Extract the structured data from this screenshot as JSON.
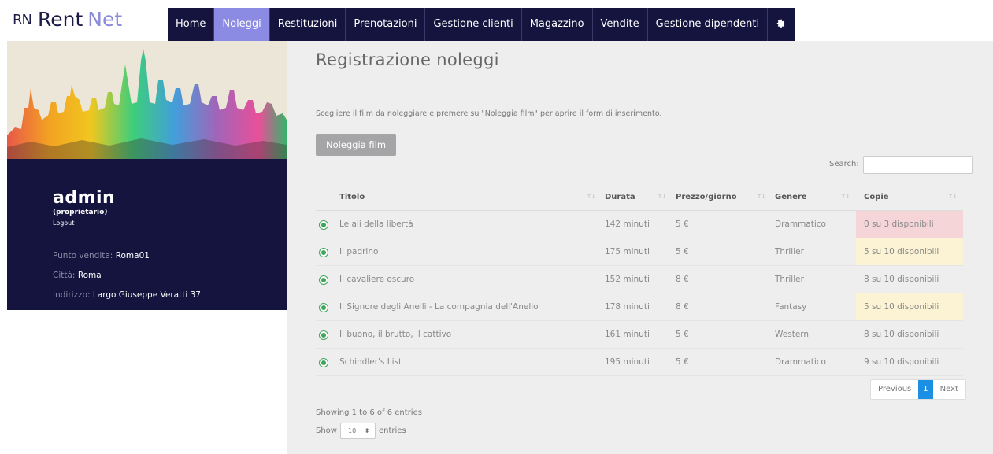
{
  "brand": {
    "mark": "RN",
    "name_a": "Rent",
    "name_b": "Net"
  },
  "nav": {
    "items": [
      {
        "label": "Home"
      },
      {
        "label": "Noleggi"
      },
      {
        "label": "Restituzioni"
      },
      {
        "label": "Prenotazioni"
      },
      {
        "label": "Gestione clienti"
      },
      {
        "label": "Magazzino"
      },
      {
        "label": "Vendite"
      },
      {
        "label": "Gestione dipendenti"
      }
    ],
    "active": "Noleggi",
    "settings_icon": "gear-icon"
  },
  "sidebar": {
    "user": "admin",
    "role": "(proprietario)",
    "logout": "Logout",
    "store_label": "Punto vendita:",
    "store": "Roma01",
    "city_label": "Città:",
    "city": "Roma",
    "address_label": "Indirizzo:",
    "address": "Largo Giuseppe Veratti 37"
  },
  "main": {
    "title": "Registrazione noleggi",
    "intro": "Scegliere il film da noleggiare e premere su \"Noleggia film\" per aprire il form di inserimento.",
    "rent_button": "Noleggia film",
    "search_label": "Search:",
    "search_value": ""
  },
  "table": {
    "columns": [
      "Titolo",
      "Durata",
      "Prezzo/giorno",
      "Genere",
      "Copie"
    ],
    "rows": [
      {
        "title": "Le ali della libertà",
        "duration": "142 minuti",
        "price": "5 €",
        "genre": "Drammatico",
        "copies": "0 su 3 disponibili",
        "status": "red"
      },
      {
        "title": "Il padrino",
        "duration": "175 minuti",
        "price": "5 €",
        "genre": "Thriller",
        "copies": "5 su 10 disponibili",
        "status": "yellow"
      },
      {
        "title": "Il cavaliere oscuro",
        "duration": "152 minuti",
        "price": "8 €",
        "genre": "Thriller",
        "copies": "8 su 10 disponibili",
        "status": "none"
      },
      {
        "title": "Il Signore degli Anelli - La compagnia dell'Anello",
        "duration": "178 minuti",
        "price": "8 €",
        "genre": "Fantasy",
        "copies": "5 su 10 disponibili",
        "status": "yellow"
      },
      {
        "title": "Il buono, il brutto, il cattivo",
        "duration": "161 minuti",
        "price": "5 €",
        "genre": "Western",
        "copies": "8 su 10 disponibili",
        "status": "none"
      },
      {
        "title": "Schindler's List",
        "duration": "195 minuti",
        "price": "5 €",
        "genre": "Drammatico",
        "copies": "9 su 10 disponibili",
        "status": "none"
      }
    ]
  },
  "pagination": {
    "previous": "Previous",
    "current": "1",
    "next": "Next"
  },
  "footer": {
    "showing": "Showing 1 to 6 of 6 entries",
    "show_label": "Show",
    "length_value": "10",
    "entries_label": "entries"
  },
  "colors": {
    "nav_bg": "#14143f",
    "nav_active": "#8b8be3",
    "row_red": "#f5d5d8",
    "row_yellow": "#fbf3d4",
    "pager_current": "#1a8fe3"
  }
}
